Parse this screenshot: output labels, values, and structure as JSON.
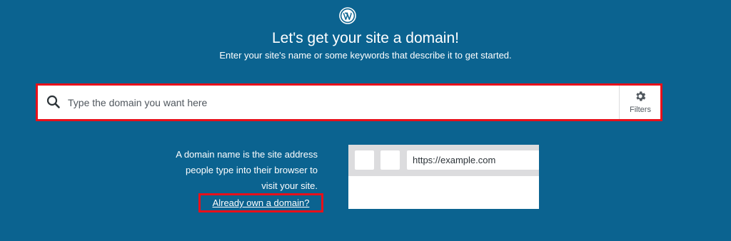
{
  "header": {
    "logo_icon": "wordpress-logo-icon",
    "title": "Let's get your site a domain!",
    "subtitle": "Enter your site's name or some keywords that describe it to get started."
  },
  "search": {
    "icon": "search-icon",
    "placeholder": "Type the domain you want here",
    "value": "",
    "filters_icon": "gear-icon",
    "filters_label": "Filters"
  },
  "explanation": {
    "line1": "A domain name is the site address",
    "line2": "people type into their browser to",
    "line3": "visit your site.",
    "own_domain_link": "Already own a domain?"
  },
  "browser_illustration": {
    "url": "https://example.com"
  },
  "colors": {
    "background": "#0b6390",
    "highlight": "#e8101a",
    "text": "#ffffff"
  }
}
